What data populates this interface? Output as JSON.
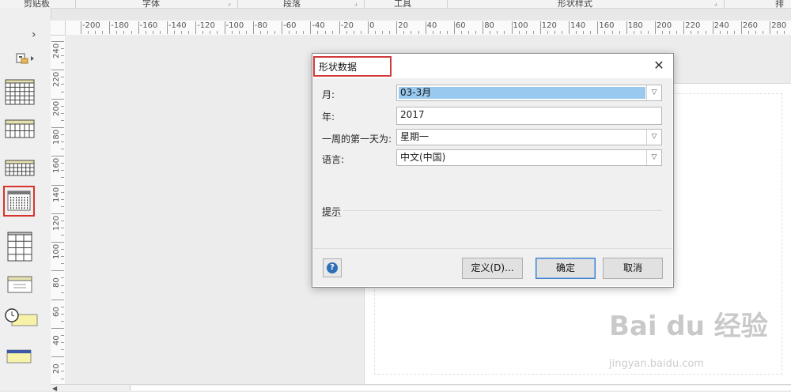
{
  "ribbon": {
    "groups": [
      {
        "label": "剪贴板"
      },
      {
        "label": "字体"
      },
      {
        "label": "段落"
      },
      {
        "label": "工具"
      },
      {
        "label": "形状样式"
      },
      {
        "label": "排列"
      }
    ]
  },
  "ruler": {
    "horizontal": [
      "-200",
      "-180",
      "-160",
      "-140",
      "-120",
      "-100",
      "-80",
      "-60",
      "-40",
      "-20",
      "0",
      "20",
      "40",
      "60",
      "80",
      "100",
      "120",
      "140",
      "160",
      "180",
      "200",
      "220",
      "240",
      "260",
      "280"
    ],
    "vertical": [
      "240",
      "220",
      "200",
      "180",
      "160",
      "140",
      "120",
      "100",
      "80",
      "60",
      "40",
      "20"
    ]
  },
  "stencil": {
    "expand_icon": "›",
    "shapes": [
      {
        "name": "calendar-grid-large-icon"
      },
      {
        "name": "calendar-week-icon"
      },
      {
        "name": "calendar-month-strip-icon"
      },
      {
        "name": "calendar-month-icon"
      },
      {
        "name": "calendar-year-icon"
      },
      {
        "name": "calendar-note-icon"
      },
      {
        "name": "timeline-clock-icon"
      },
      {
        "name": "calendar-bar-icon"
      }
    ],
    "selected_index": 3
  },
  "dialog": {
    "title": "形状数据",
    "close": "✕",
    "fields": {
      "month": {
        "label": "月:",
        "value": "03-3月"
      },
      "year": {
        "label": "年:",
        "value": "2017"
      },
      "first_day": {
        "label": "一周的第一天为:",
        "value": "星期一"
      },
      "language": {
        "label": "语言:",
        "value": "中文(中国)"
      }
    },
    "hint_label": "提示",
    "help": "?",
    "buttons": {
      "define": "定义(D)...",
      "ok": "确定",
      "cancel": "取消"
    }
  },
  "watermark": {
    "brand": "Bai du 经验",
    "url": "jingyan.baidu.com"
  },
  "colors": {
    "accent_selected_field": "#99c9ef",
    "highlight_red": "#d03a3a",
    "help_blue": "#2f6fb6"
  }
}
